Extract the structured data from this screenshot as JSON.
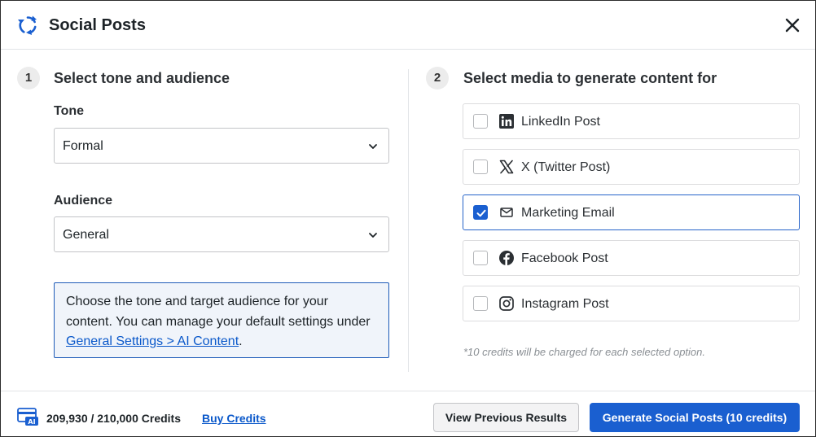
{
  "header": {
    "title": "Social Posts",
    "logo_icon": "refresh-cycle-icon",
    "close_icon": "close-icon"
  },
  "step1": {
    "number": "1",
    "title": "Select tone and audience",
    "tone": {
      "label": "Tone",
      "value": "Formal"
    },
    "audience": {
      "label": "Audience",
      "value": "General"
    },
    "info": {
      "text": "Choose the tone and target audience for your content. You can manage your default settings under ",
      "link": "General Settings > AI Content",
      "suffix": "."
    }
  },
  "step2": {
    "number": "2",
    "title": "Select media to generate content for",
    "options": [
      {
        "label": "LinkedIn Post",
        "icon": "linkedin-icon",
        "checked": false
      },
      {
        "label": "X (Twitter Post)",
        "icon": "x-twitter-icon",
        "checked": false
      },
      {
        "label": "Marketing Email",
        "icon": "mail-icon",
        "checked": true
      },
      {
        "label": "Facebook Post",
        "icon": "facebook-icon",
        "checked": false
      },
      {
        "label": "Instagram Post",
        "icon": "instagram-icon",
        "checked": false
      }
    ],
    "note": "*10 credits will be charged for each selected option."
  },
  "footer": {
    "credits_icon": "ai-credit-card-icon",
    "credits": "209,930 / 210,000 Credits",
    "buy_credits": "Buy Credits",
    "view_previous": "View Previous Results",
    "generate": "Generate Social Posts (10 credits)"
  },
  "colors": {
    "primary": "#1a5fd0",
    "link": "#0a58ca",
    "info_border": "#1e5bb8",
    "info_bg": "#f0f4fa"
  }
}
